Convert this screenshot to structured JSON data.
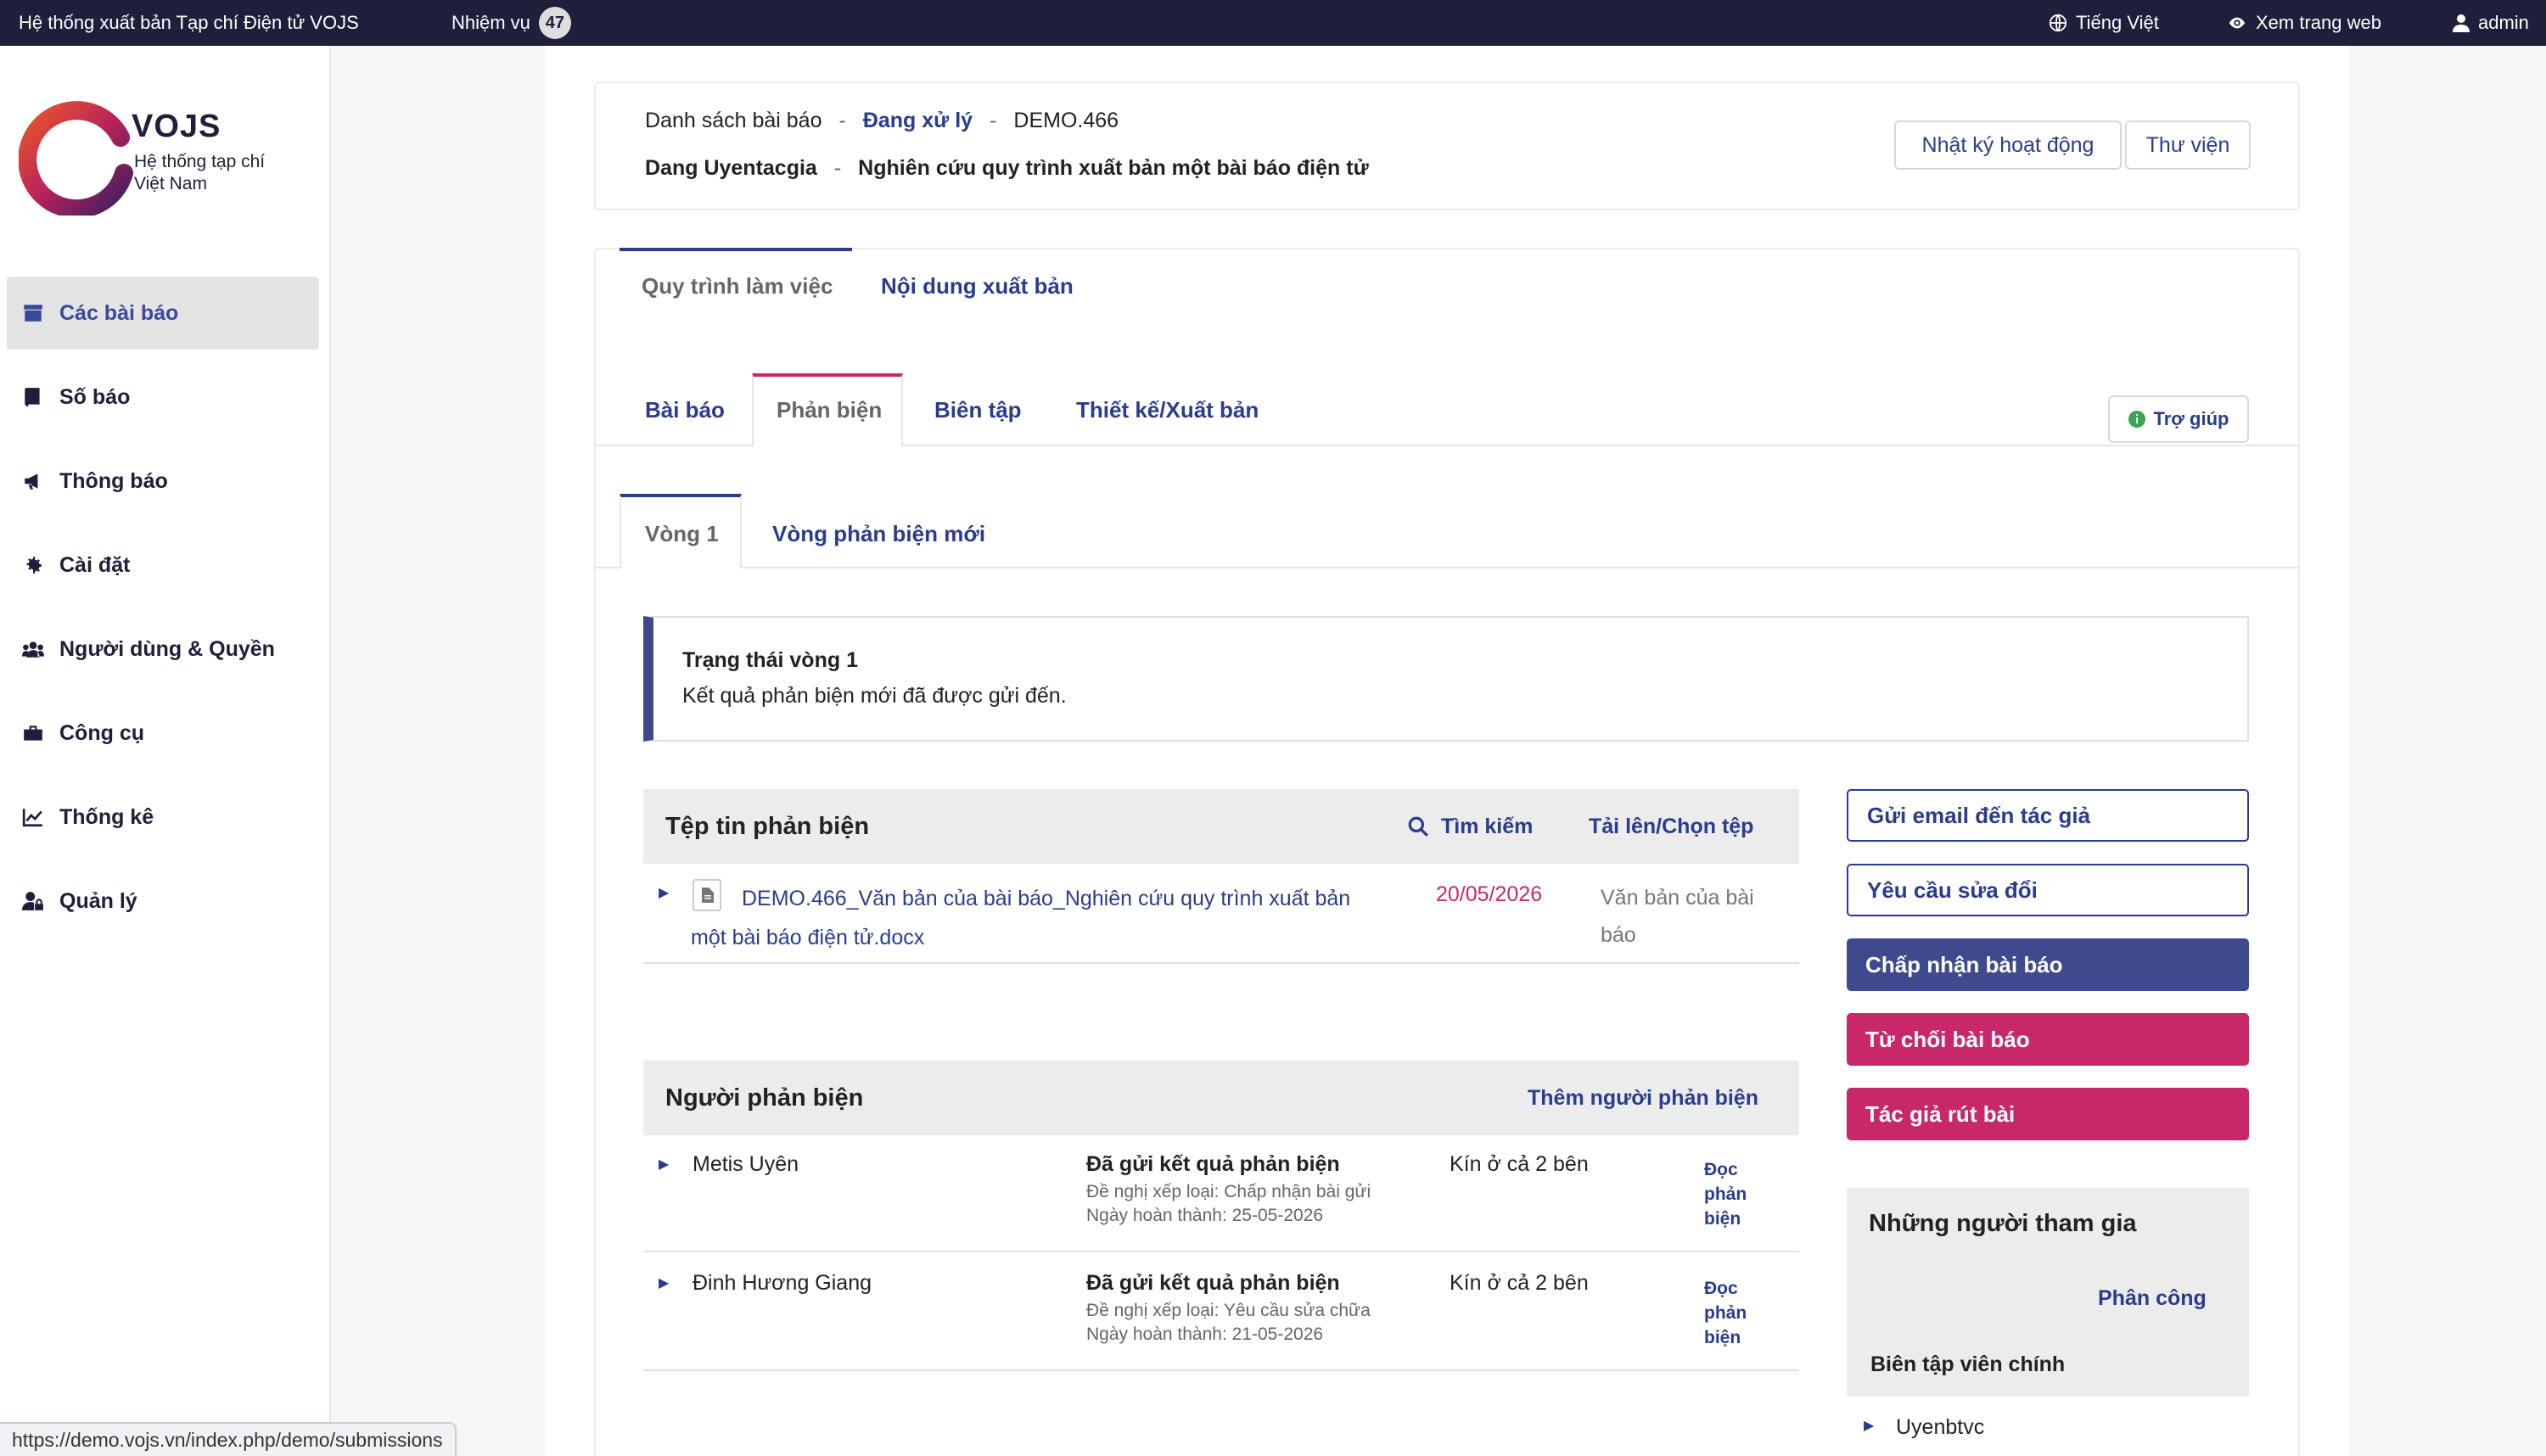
{
  "topbar": {
    "site_title": "Hệ thống xuất bản Tạp chí Điện tử VOJS",
    "tasks_label": "Nhiệm vụ",
    "tasks_count": "47",
    "language": "Tiếng Việt",
    "view_site": "Xem trang web",
    "user": "admin"
  },
  "logo": {
    "name": "VOJS",
    "subtitle_line1": "Hệ thống tạp chí",
    "subtitle_line2": "Việt Nam"
  },
  "sidebar": {
    "items": [
      {
        "label": "Các bài báo",
        "icon": "archive-icon",
        "active": true
      },
      {
        "label": "Số báo",
        "icon": "book-icon",
        "active": false
      },
      {
        "label": "Thông báo",
        "icon": "megaphone-icon",
        "active": false
      },
      {
        "label": "Cài đặt",
        "icon": "gear-icon",
        "active": false
      },
      {
        "label": "Người dùng & Quyền",
        "icon": "users-icon",
        "active": false
      },
      {
        "label": "Công cụ",
        "icon": "toolbox-icon",
        "active": false
      },
      {
        "label": "Thống kê",
        "icon": "chart-icon",
        "active": false
      },
      {
        "label": "Quản lý",
        "icon": "user-lock-icon",
        "active": false
      }
    ]
  },
  "status_url": "https://demo.vojs.vn/index.php/demo/submissions",
  "header": {
    "breadcrumb_root": "Danh sách bài báo",
    "breadcrumb_sep": "-",
    "breadcrumb_status": "Đang xử lý",
    "breadcrumb_id": "DEMO.466",
    "author": "Dang Uyentacgia",
    "article_title": "Nghiên cứu quy trình xuất bản một bài báo điện tử",
    "activity_log_button": "Nhật ký hoạt động",
    "library_button": "Thư viện"
  },
  "main_tabs": {
    "workflow": "Quy trình làm việc",
    "publication": "Nội dung xuất bản"
  },
  "stage_tabs": {
    "submission": "Bài báo",
    "review": "Phản biện",
    "copyediting": "Biên tập",
    "production": "Thiết kế/Xuất bản",
    "help": "Trợ giúp"
  },
  "round_tabs": {
    "round1": "Vòng 1",
    "new_round": "Vòng phản biện mới"
  },
  "round_status": {
    "title": "Trạng thái vòng 1",
    "message": "Kết quả phản biện mới đã được gửi đến."
  },
  "review_files": {
    "title": "Tệp tin phản biện",
    "search_label": "Tìm kiếm",
    "upload_label": "Tải lên/Chọn tệp",
    "files": [
      {
        "name_line1": "DEMO.466_Văn bản của bài báo_Nghiên cứu quy trình xuất bản",
        "name_line2": "một bài báo điện tử.docx",
        "date": "20/05/2026",
        "type_line1": "Văn bản của bài",
        "type_line2": "báo"
      }
    ]
  },
  "reviewers": {
    "title": "Người phản biện",
    "add_label": "Thêm người phản biện",
    "rows": [
      {
        "name": "Metis Uyên",
        "status": "Đã gửi kết quả phản biện",
        "recommendation": "Đề nghị xếp loại: Chấp nhận bài gửi",
        "completed": "Ngày hoàn thành: 25-05-2026",
        "method": "Kín ở cả 2 bên",
        "action_line1": "Đọc",
        "action_line2": "phản",
        "action_line3": "biện"
      },
      {
        "name": "Đinh Hương Giang",
        "status": "Đã gửi kết quả phản biện",
        "recommendation": "Đề nghị xếp loại: Yêu cầu sửa chữa",
        "completed": "Ngày hoàn thành: 21-05-2026",
        "method": "Kín ở cả 2 bên",
        "action_line1": "Đọc",
        "action_line2": "phản",
        "action_line3": "biện"
      }
    ]
  },
  "actions": {
    "email_author": "Gửi email đến tác giả",
    "request_revisions": "Yêu cầu sửa đổi",
    "accept": "Chấp nhận bài báo",
    "decline": "Từ chối bài báo",
    "withdraw": "Tác giả rút bài"
  },
  "participants": {
    "title": "Những người tham gia",
    "assign_label": "Phân công",
    "group_label": "Biên tập viên chính",
    "members": [
      "Uyenbtvc"
    ]
  },
  "colors": {
    "topbar": "#1e1f3b",
    "link": "#2a3c8e",
    "primary": "#3f4a8e",
    "danger": "#c8286a",
    "date": "#c8286a"
  }
}
